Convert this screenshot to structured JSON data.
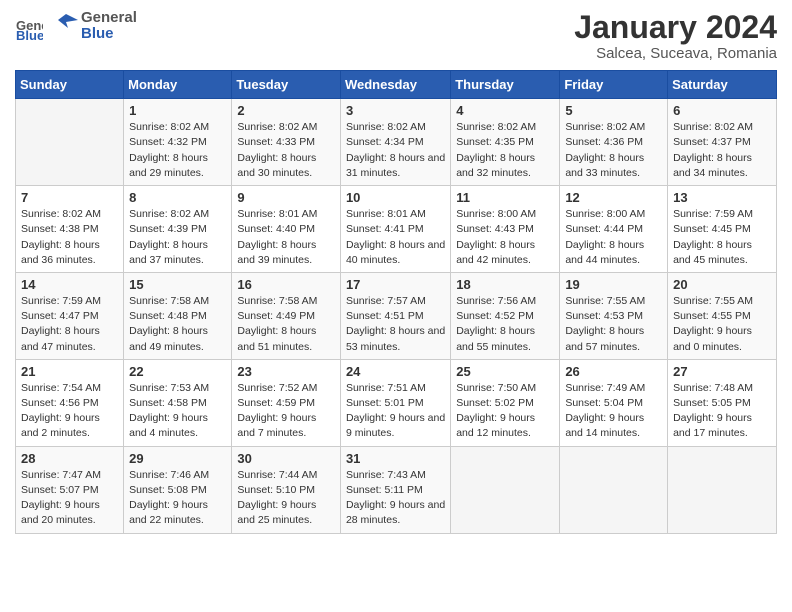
{
  "header": {
    "logo_general": "General",
    "logo_blue": "Blue",
    "main_title": "January 2024",
    "subtitle": "Salcea, Suceava, Romania"
  },
  "columns": [
    "Sunday",
    "Monday",
    "Tuesday",
    "Wednesday",
    "Thursday",
    "Friday",
    "Saturday"
  ],
  "weeks": [
    [
      {
        "day": "",
        "info": ""
      },
      {
        "day": "1",
        "info": "Sunrise: 8:02 AM\nSunset: 4:32 PM\nDaylight: 8 hours\nand 29 minutes."
      },
      {
        "day": "2",
        "info": "Sunrise: 8:02 AM\nSunset: 4:33 PM\nDaylight: 8 hours\nand 30 minutes."
      },
      {
        "day": "3",
        "info": "Sunrise: 8:02 AM\nSunset: 4:34 PM\nDaylight: 8 hours\nand 31 minutes."
      },
      {
        "day": "4",
        "info": "Sunrise: 8:02 AM\nSunset: 4:35 PM\nDaylight: 8 hours\nand 32 minutes."
      },
      {
        "day": "5",
        "info": "Sunrise: 8:02 AM\nSunset: 4:36 PM\nDaylight: 8 hours\nand 33 minutes."
      },
      {
        "day": "6",
        "info": "Sunrise: 8:02 AM\nSunset: 4:37 PM\nDaylight: 8 hours\nand 34 minutes."
      }
    ],
    [
      {
        "day": "7",
        "info": "Sunrise: 8:02 AM\nSunset: 4:38 PM\nDaylight: 8 hours\nand 36 minutes."
      },
      {
        "day": "8",
        "info": "Sunrise: 8:02 AM\nSunset: 4:39 PM\nDaylight: 8 hours\nand 37 minutes."
      },
      {
        "day": "9",
        "info": "Sunrise: 8:01 AM\nSunset: 4:40 PM\nDaylight: 8 hours\nand 39 minutes."
      },
      {
        "day": "10",
        "info": "Sunrise: 8:01 AM\nSunset: 4:41 PM\nDaylight: 8 hours\nand 40 minutes."
      },
      {
        "day": "11",
        "info": "Sunrise: 8:00 AM\nSunset: 4:43 PM\nDaylight: 8 hours\nand 42 minutes."
      },
      {
        "day": "12",
        "info": "Sunrise: 8:00 AM\nSunset: 4:44 PM\nDaylight: 8 hours\nand 44 minutes."
      },
      {
        "day": "13",
        "info": "Sunrise: 7:59 AM\nSunset: 4:45 PM\nDaylight: 8 hours\nand 45 minutes."
      }
    ],
    [
      {
        "day": "14",
        "info": "Sunrise: 7:59 AM\nSunset: 4:47 PM\nDaylight: 8 hours\nand 47 minutes."
      },
      {
        "day": "15",
        "info": "Sunrise: 7:58 AM\nSunset: 4:48 PM\nDaylight: 8 hours\nand 49 minutes."
      },
      {
        "day": "16",
        "info": "Sunrise: 7:58 AM\nSunset: 4:49 PM\nDaylight: 8 hours\nand 51 minutes."
      },
      {
        "day": "17",
        "info": "Sunrise: 7:57 AM\nSunset: 4:51 PM\nDaylight: 8 hours\nand 53 minutes."
      },
      {
        "day": "18",
        "info": "Sunrise: 7:56 AM\nSunset: 4:52 PM\nDaylight: 8 hours\nand 55 minutes."
      },
      {
        "day": "19",
        "info": "Sunrise: 7:55 AM\nSunset: 4:53 PM\nDaylight: 8 hours\nand 57 minutes."
      },
      {
        "day": "20",
        "info": "Sunrise: 7:55 AM\nSunset: 4:55 PM\nDaylight: 9 hours\nand 0 minutes."
      }
    ],
    [
      {
        "day": "21",
        "info": "Sunrise: 7:54 AM\nSunset: 4:56 PM\nDaylight: 9 hours\nand 2 minutes."
      },
      {
        "day": "22",
        "info": "Sunrise: 7:53 AM\nSunset: 4:58 PM\nDaylight: 9 hours\nand 4 minutes."
      },
      {
        "day": "23",
        "info": "Sunrise: 7:52 AM\nSunset: 4:59 PM\nDaylight: 9 hours\nand 7 minutes."
      },
      {
        "day": "24",
        "info": "Sunrise: 7:51 AM\nSunset: 5:01 PM\nDaylight: 9 hours\nand 9 minutes."
      },
      {
        "day": "25",
        "info": "Sunrise: 7:50 AM\nSunset: 5:02 PM\nDaylight: 9 hours\nand 12 minutes."
      },
      {
        "day": "26",
        "info": "Sunrise: 7:49 AM\nSunset: 5:04 PM\nDaylight: 9 hours\nand 14 minutes."
      },
      {
        "day": "27",
        "info": "Sunrise: 7:48 AM\nSunset: 5:05 PM\nDaylight: 9 hours\nand 17 minutes."
      }
    ],
    [
      {
        "day": "28",
        "info": "Sunrise: 7:47 AM\nSunset: 5:07 PM\nDaylight: 9 hours\nand 20 minutes."
      },
      {
        "day": "29",
        "info": "Sunrise: 7:46 AM\nSunset: 5:08 PM\nDaylight: 9 hours\nand 22 minutes."
      },
      {
        "day": "30",
        "info": "Sunrise: 7:44 AM\nSunset: 5:10 PM\nDaylight: 9 hours\nand 25 minutes."
      },
      {
        "day": "31",
        "info": "Sunrise: 7:43 AM\nSunset: 5:11 PM\nDaylight: 9 hours\nand 28 minutes."
      },
      {
        "day": "",
        "info": ""
      },
      {
        "day": "",
        "info": ""
      },
      {
        "day": "",
        "info": ""
      }
    ]
  ]
}
